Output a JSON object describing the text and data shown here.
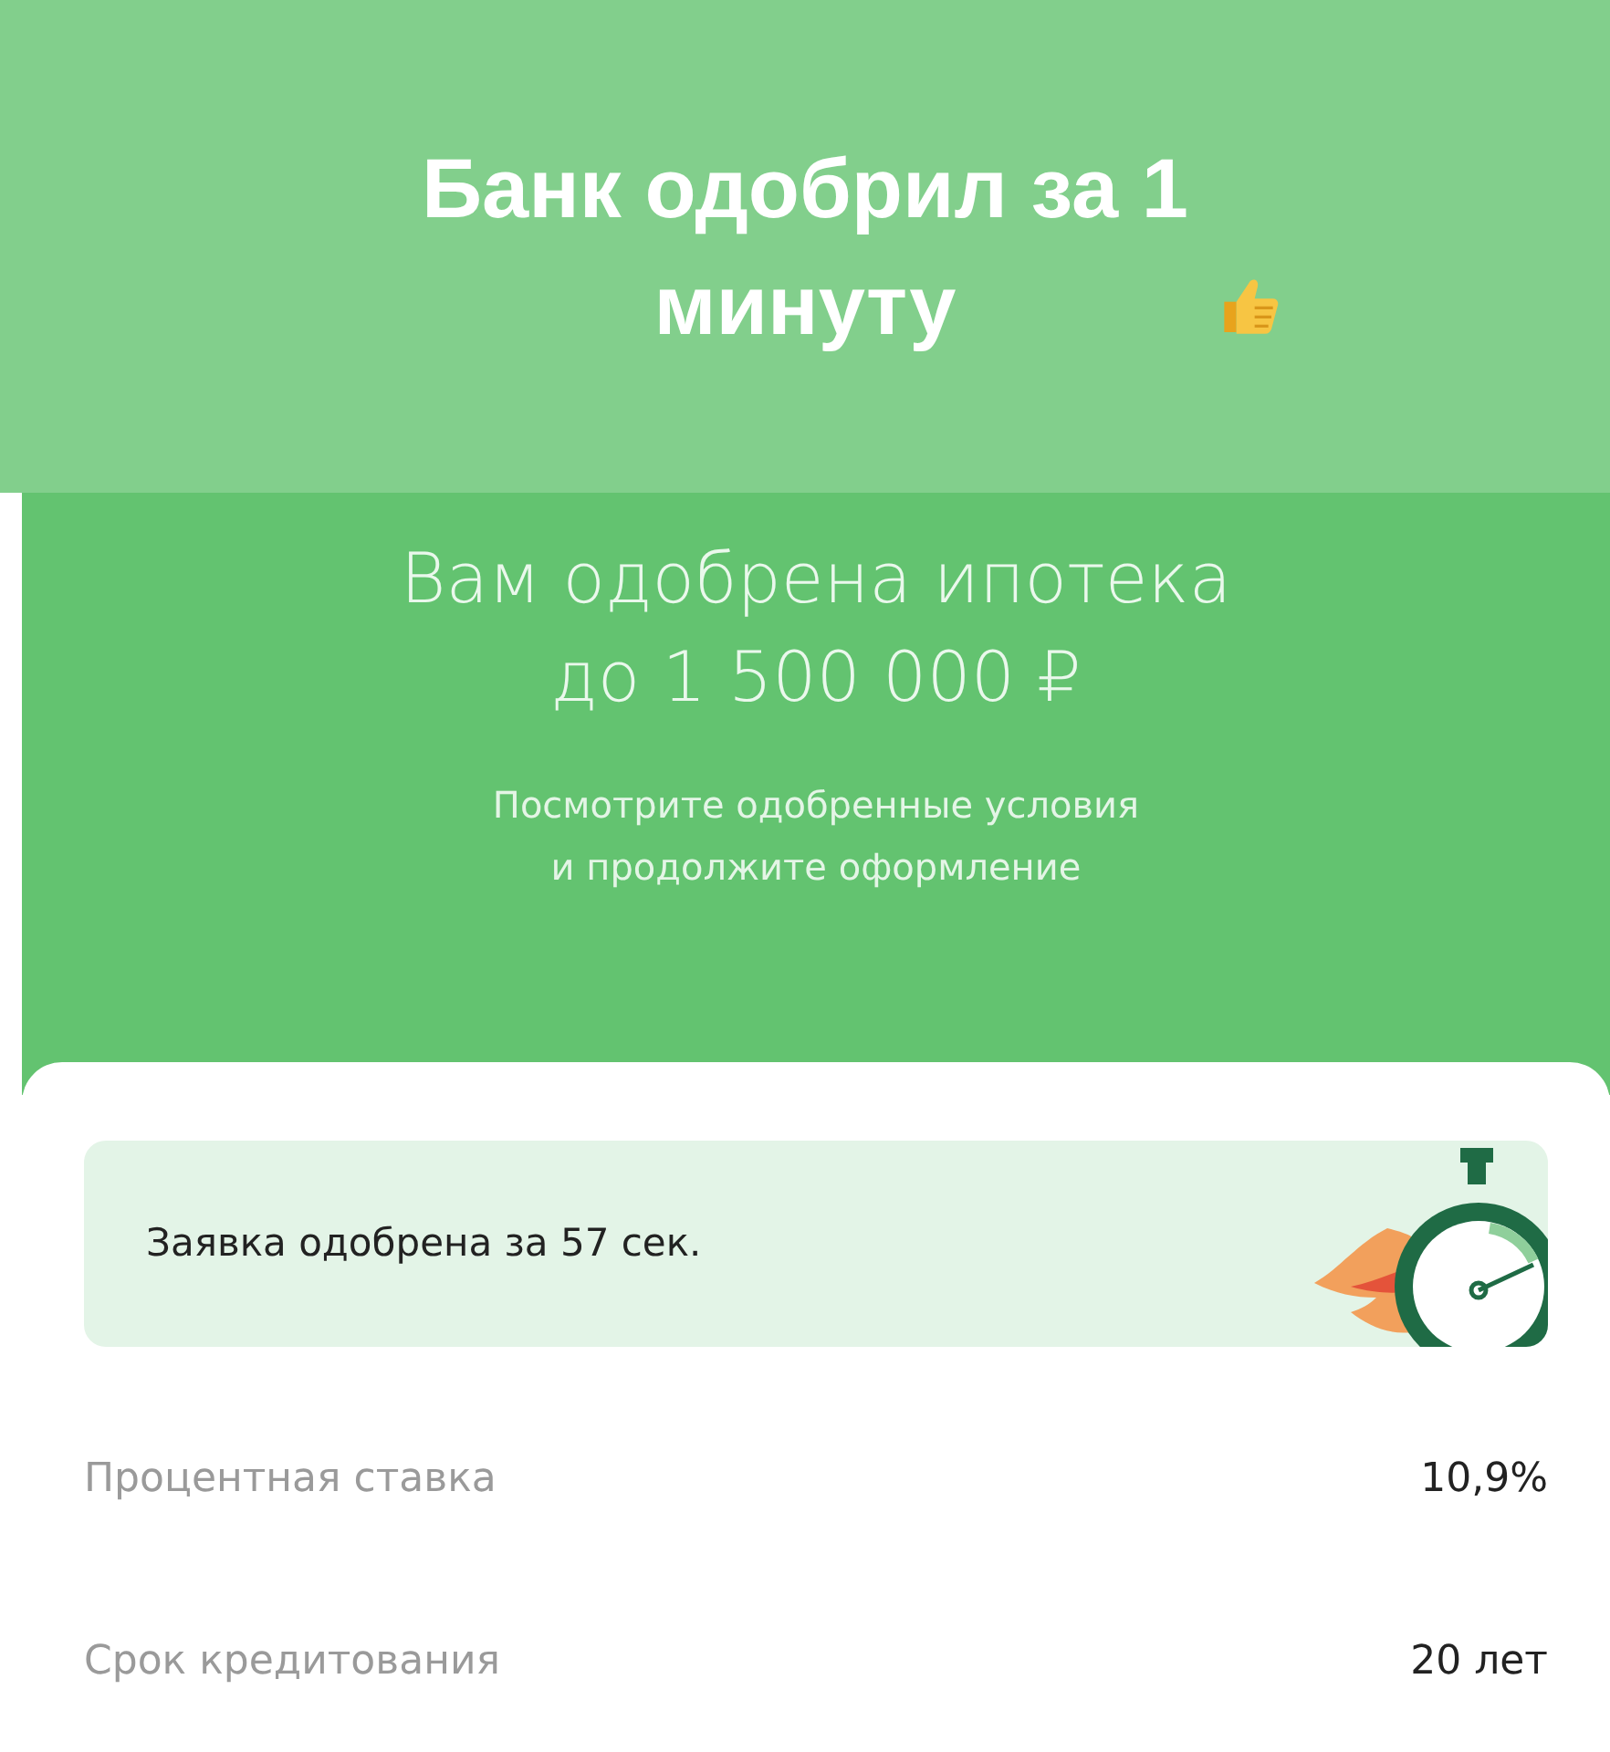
{
  "caption": {
    "title": "Банк одобрил за 1 минуту"
  },
  "header": {
    "title": "Вам одобрена ипотека\nдо 1 500 000 ₽",
    "subtitle": "Посмотрите одобренные условия\nи продолжите оформление"
  },
  "notice": {
    "text": "Заявка одобрена за 57 сек."
  },
  "terms": [
    {
      "label": "Процентная ставка",
      "value": "10,9%"
    },
    {
      "label": "Срок кредитования",
      "value": "20 лет"
    }
  ]
}
